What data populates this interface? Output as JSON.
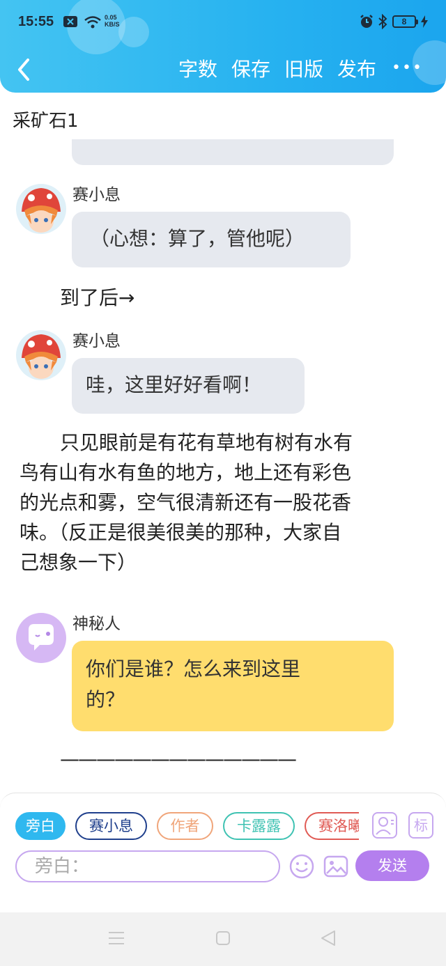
{
  "status_bar": {
    "time": "15:55",
    "net_speed_value": "0.05",
    "net_speed_unit": "KB/S",
    "battery": "8"
  },
  "toolbar": {
    "actions": [
      "字数",
      "保存",
      "旧版",
      "发布"
    ],
    "more_label": "•••"
  },
  "document": {
    "title": "采矿石1"
  },
  "story": {
    "msg1": {
      "speaker": "赛小息",
      "text": "（心想：算了，管他呢）"
    },
    "narration1": "到了后→",
    "msg2": {
      "speaker": "赛小息",
      "text": "哇，这里好好看啊！"
    },
    "narration2": [
      "只见眼前是有花有草地有树有水有",
      "鸟有山有水有鱼的地方，地上还有彩色",
      "的光点和雾，空气很清新还有一股花香",
      "味。（反正是很美很美的那种，大家自",
      "己想象一下）"
    ],
    "msg3": {
      "speaker": "神秘人",
      "lines": [
        "你们是谁？怎么来到这里",
        "的？"
      ]
    },
    "separator": "—————————————"
  },
  "roles": [
    {
      "label": "旁白",
      "color": "#2fb8ef",
      "selected": true
    },
    {
      "label": "赛小息",
      "color": "#1f3f8c",
      "selected": false
    },
    {
      "label": "作者",
      "color": "#f0a57a",
      "selected": false
    },
    {
      "label": "卡露露",
      "color": "#3ec2b2",
      "selected": false
    },
    {
      "label": "赛洛曦",
      "color": "#e05a54",
      "selected": false
    }
  ],
  "composer": {
    "placeholder": "旁白：",
    "send_label": "发送",
    "tag_label": "标"
  },
  "colors": {
    "header": "#27b2f0",
    "accent_purple": "#b47fee",
    "bubble_gray": "#e6e9ef",
    "bubble_yellow": "#ffdd6e"
  }
}
